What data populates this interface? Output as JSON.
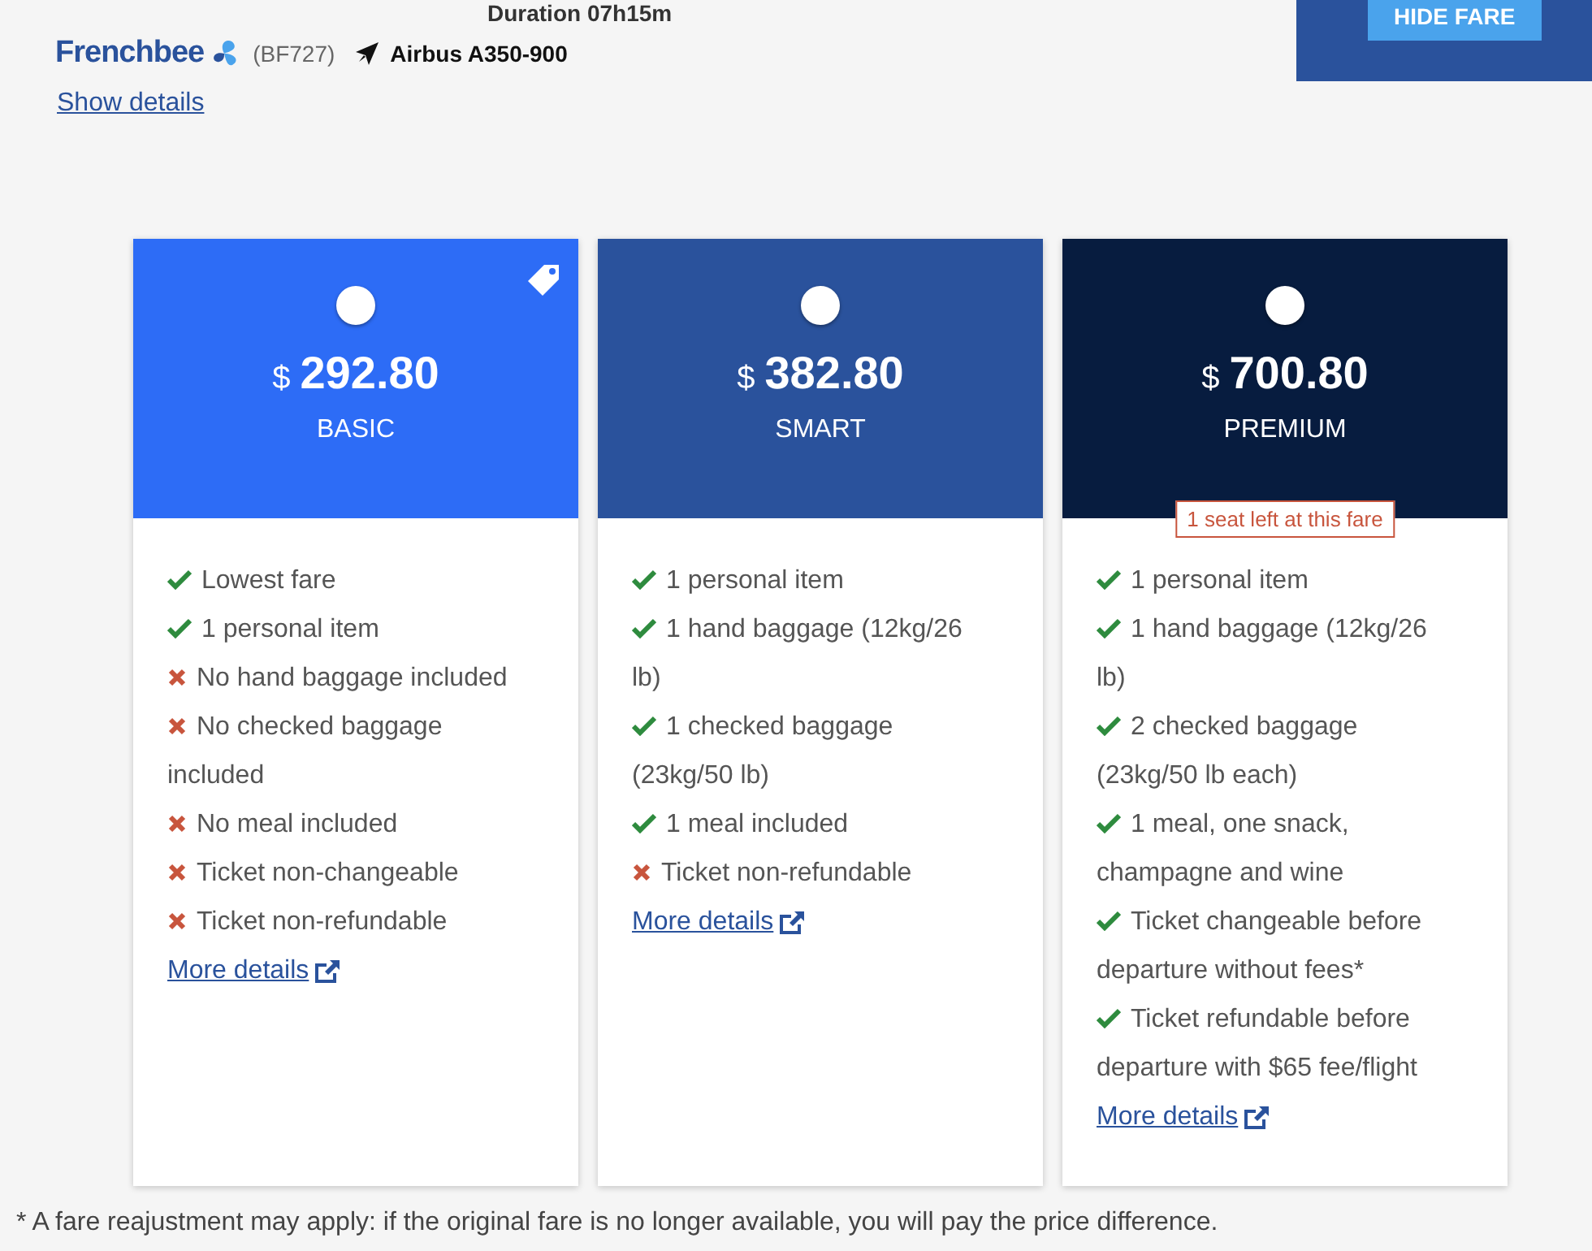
{
  "flight": {
    "duration": "Duration 07h15m",
    "airline": "Frenchbee",
    "flight_number": "(BF727)",
    "aircraft": "Airbus A350-900",
    "show_details": "Show details"
  },
  "hide_fare_button": "HIDE FARE",
  "fares": [
    {
      "currency": "$",
      "price": "292.80",
      "name": "BASIC",
      "color": "#2d6cf6",
      "selected": false,
      "tagged": true,
      "features": [
        {
          "kind": "included",
          "text": "Lowest fare"
        },
        {
          "kind": "included",
          "text": "1 personal item"
        },
        {
          "kind": "excluded",
          "text": "No hand baggage included"
        },
        {
          "kind": "excluded",
          "text": "No checked baggage included"
        },
        {
          "kind": "excluded",
          "text": "No meal included"
        },
        {
          "kind": "excluded",
          "text": "Ticket non-changeable"
        },
        {
          "kind": "excluded",
          "text": "Ticket non-refundable"
        }
      ],
      "more": "More details"
    },
    {
      "currency": "$",
      "price": "382.80",
      "name": "SMART",
      "color": "#2a529c",
      "selected": false,
      "tagged": false,
      "features": [
        {
          "kind": "included",
          "text": "1 personal item"
        },
        {
          "kind": "included",
          "text": "1 hand baggage (12kg/26 lb)"
        },
        {
          "kind": "included",
          "text": "1 checked baggage (23kg/50 lb)"
        },
        {
          "kind": "included",
          "text": "1 meal included"
        },
        {
          "kind": "excluded",
          "text": "Ticket non-refundable"
        }
      ],
      "more": "More details"
    },
    {
      "currency": "$",
      "price": "700.80",
      "name": "PREMIUM",
      "color": "#071c3f",
      "selected": false,
      "tagged": false,
      "notice": "1 seat left at this fare",
      "features": [
        {
          "kind": "included",
          "text": "1 personal item"
        },
        {
          "kind": "included",
          "text": "1 hand baggage (12kg/26 lb)"
        },
        {
          "kind": "included",
          "text": "2 checked baggage (23kg/50 lb each)"
        },
        {
          "kind": "included",
          "text": "1 meal, one snack, champagne and wine"
        },
        {
          "kind": "included",
          "text": "Ticket changeable before departure without fees*"
        },
        {
          "kind": "included",
          "text": "Ticket refundable before departure with $65 fee/flight"
        }
      ],
      "more": "More details"
    }
  ],
  "footnote": "* A fare reajustment may apply: if the original fare is no longer available, you will pay the price difference."
}
